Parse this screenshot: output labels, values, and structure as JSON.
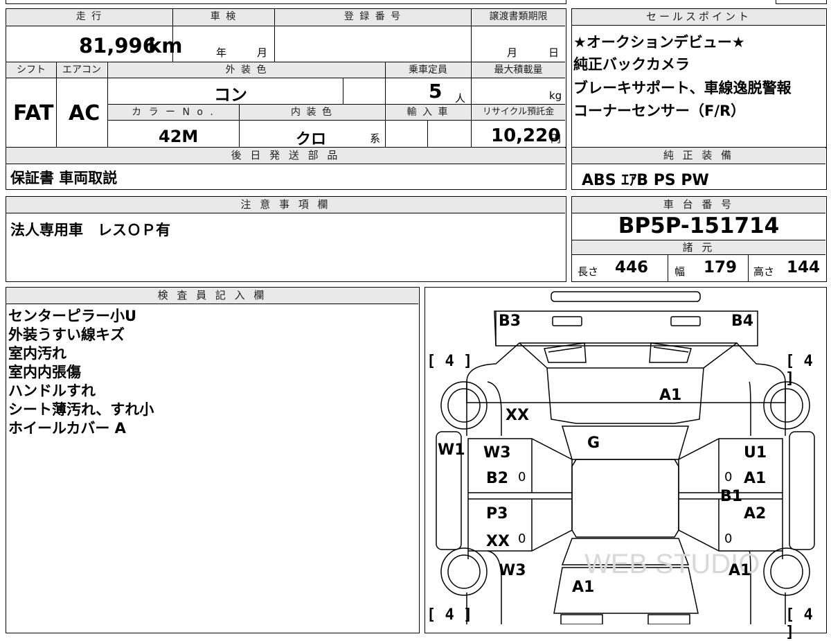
{
  "spec": {
    "headers": {
      "mileage": "走 行",
      "inspection": "車 検",
      "registration": "登 録 番 号",
      "transfer_deadline": "譲渡書類期限",
      "shift": "シフト",
      "aircon": "エアコン",
      "exterior_color": "外 装 色",
      "capacity": "乗車定員",
      "max_load": "最大積載量",
      "color_no": "カ ラ ー N o .",
      "interior_color": "内 装 色",
      "import": "輸 入 車",
      "recycle": "リサイクル預託金"
    },
    "mileage_value": "81,996",
    "mileage_unit": "km",
    "inspection_year_unit": "年",
    "inspection_month_unit": "月",
    "transfer_month_unit": "月",
    "transfer_day_unit": "日",
    "shift_value": "FAT",
    "aircon_value": "AC",
    "exterior_color_value": "コン",
    "capacity_value": "5",
    "capacity_unit": "人",
    "max_load_unit": "kg",
    "color_no_value": "42M",
    "interior_color_value": "クロ",
    "interior_color_suffix": "系",
    "recycle_value": "10,220",
    "recycle_unit": "円"
  },
  "sales_points": {
    "header": "セールスポイント",
    "lines": [
      "★オークションデビュー★",
      "純正バックカメラ",
      "ブレーキサポート、車線逸脱警報",
      "コーナーセンサー（F/R）"
    ]
  },
  "later_parts": {
    "header": "後 日 発 送 部 品",
    "value": "保証書 車両取説"
  },
  "factory_equipment": {
    "header": "純 正 装 備",
    "value": "ABS ｴｱB PS PW"
  },
  "notes": {
    "header": "注 意 事 項 欄",
    "value": "法人専用車　レスＯＰ有"
  },
  "chassis": {
    "header": "車 台 番 号",
    "value": "BP5P-151714"
  },
  "dimensions": {
    "header": "諸 元",
    "length_label": "長さ",
    "length_value": "446",
    "width_label": "幅",
    "width_value": "179",
    "height_label": "高さ",
    "height_value": "144"
  },
  "inspector": {
    "header": "検 査 員 記 入 欄",
    "lines": [
      "センターピラー小U",
      "外装うすい線キズ",
      "室内汚れ",
      "室内内張傷",
      "ハンドルすれ",
      "シート薄汚れ、すれ小",
      "ホイールカバー A"
    ]
  },
  "diagram": {
    "tire_tl": "[ 4 ]",
    "tire_tr": "[ 4 ]",
    "tire_bl": "[ 4 ]",
    "tire_br": "[ 4 ]",
    "labels": {
      "b3": "B3",
      "b4": "B4",
      "a1_hood": "A1",
      "xx_front": "XX",
      "g": "G",
      "w1": "W1",
      "w3_front": "W3",
      "b2": "B2",
      "zero_1": "0",
      "u1": "U1",
      "zero_2": "0",
      "a1_rdoor": "A1",
      "b1": "B1",
      "p3": "P3",
      "xx_rear": "XX",
      "zero_3": "0",
      "a2": "A2",
      "zero_4": "0",
      "w3_rear": "W3",
      "a1_rfender": "A1",
      "a1_trunk": "A1"
    },
    "watermark": "WEB STUDIO"
  }
}
